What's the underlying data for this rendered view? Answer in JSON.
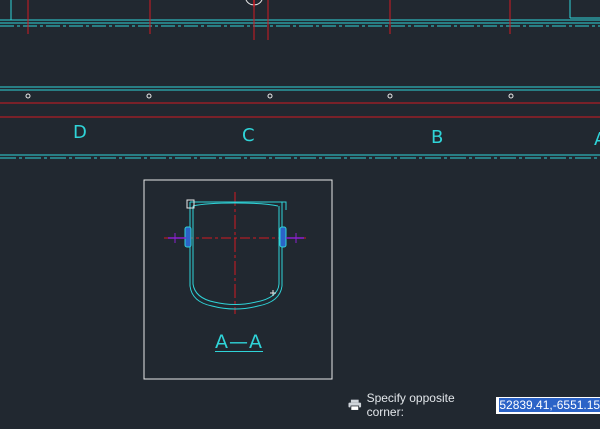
{
  "drawing": {
    "zone_labels": [
      "D",
      "C",
      "B",
      "A"
    ],
    "section_label": "A—A"
  },
  "command_line": {
    "prompt": "Specify opposite corner:",
    "input_value": "52839.41,-6551.15"
  },
  "colors": {
    "background": "#212830",
    "cyan": "#2fd4d8",
    "red": "#d11a22",
    "white": "#e8e8e8",
    "blue": "#2b63c7",
    "magenta": "#8a1fd0"
  }
}
